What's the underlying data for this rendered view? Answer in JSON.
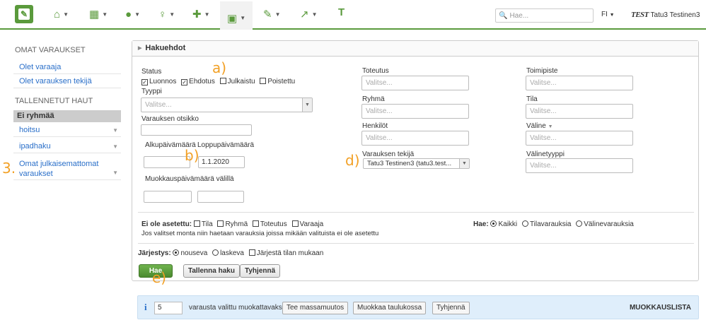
{
  "nav": {
    "search_placeholder": "Hae...",
    "language": "FI",
    "env_badge": "TEST",
    "user_name": "Tatu3 Testinen3",
    "last_item": "T"
  },
  "sidebar": {
    "heading_own": "OMAT VARAUKSET",
    "link_booker": "Olet varaaja",
    "link_creator": "Olet varauksen tekijä",
    "heading_saved": "TALLENNETUT HAUT",
    "group_label": "Ei ryhmää",
    "saved_items": [
      "hoitsu",
      "ipadhaku",
      "Omat julkaisemattomat varaukset"
    ]
  },
  "annotations": {
    "a": "a)",
    "b": "b)",
    "d": "d)",
    "e": "e)",
    "three": "3."
  },
  "panel": {
    "title": "Hakuehdot",
    "status_label": "Status",
    "status_options": [
      {
        "label": "Luonnos",
        "checked": true
      },
      {
        "label": "Ehdotus",
        "checked": true
      },
      {
        "label": "Julkaistu",
        "checked": false
      },
      {
        "label": "Poistettu",
        "checked": false
      }
    ],
    "type_label": "Tyyppi",
    "type_placeholder": "Valitse...",
    "title_label": "Varauksen otsikko",
    "start_label": "Alkupäivämäärä",
    "end_label": "Loppupäivämäärä",
    "end_value": "1.1.2020",
    "modified_label": "Muokkauspäivämäärä välillä",
    "toteutus_label": "Toteutus",
    "ryhma_label": "Ryhmä",
    "henkilot_label": "Henkilöt",
    "creator_label": "Varauksen tekijä",
    "creator_value": "Tatu3 Testinen3 (tatu3.test...",
    "toimipiste_label": "Toimipiste",
    "tila_label": "Tila",
    "valine_label": "Väline",
    "valinetyyppi_label": "Välinetyyppi",
    "placeholder": "Valitse...",
    "unset_label": "Ei ole asetettu:",
    "unset_options": [
      "Tila",
      "Ryhmä",
      "Toteutus",
      "Varaaja"
    ],
    "unset_help": "Jos valitset monta niin haetaan varauksia joissa mikään valituista ei ole asetettu",
    "hae_label": "Hae:",
    "hae_options": [
      {
        "label": "Kaikki",
        "selected": true
      },
      {
        "label": "Tilavarauksia",
        "selected": false
      },
      {
        "label": "Välinevarauksia",
        "selected": false
      }
    ],
    "order_label": "Järjestys:",
    "order_options": [
      {
        "label": "nouseva",
        "selected": true
      },
      {
        "label": "laskeva",
        "selected": false
      }
    ],
    "order_by_room": "Järjestä tilan mukaan",
    "btn_search": "Hae",
    "btn_save": "Tallenna haku",
    "btn_clear": "Tyhjennä"
  },
  "massbar": {
    "count": "5",
    "text": "varausta valittu muokattavaksi.",
    "btn_mass": "Tee massamuutos",
    "btn_table": "Muokkaa taulukossa",
    "btn_clear": "Tyhjennä",
    "list_label": "MUOKKAUSLISTA"
  },
  "colors": {
    "brand": "#5a9a3c",
    "link": "#2a6fc9",
    "annotation": "#f2a025"
  }
}
